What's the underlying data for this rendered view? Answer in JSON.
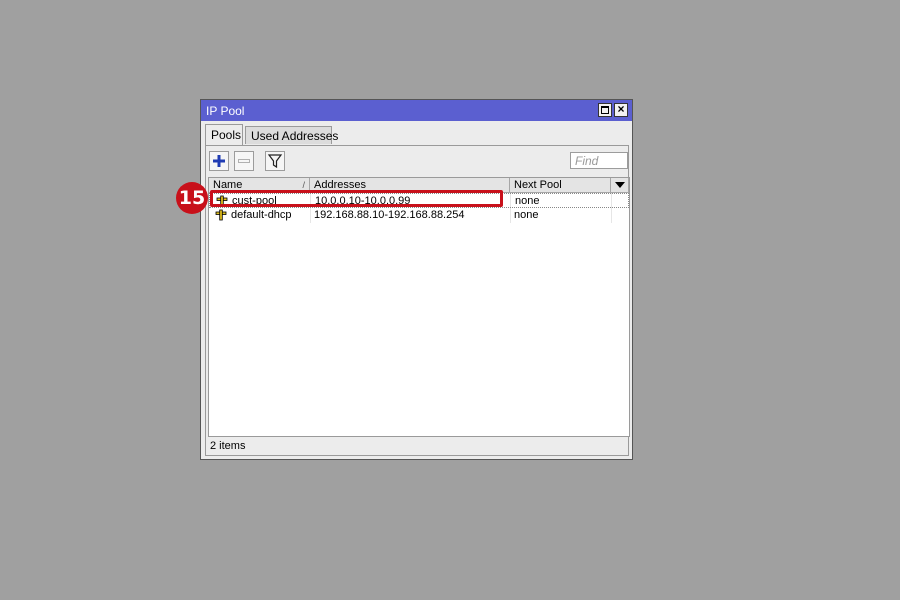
{
  "window": {
    "title": "IP Pool"
  },
  "tabs": [
    {
      "label": "Pools"
    },
    {
      "label": "Used Addresses"
    }
  ],
  "toolbar": {
    "add_icon": "plus-icon",
    "remove_icon": "minus-icon",
    "filter_icon": "filter-icon",
    "find_placeholder": "Find"
  },
  "table": {
    "columns": [
      "Name",
      "Addresses",
      "Next Pool"
    ],
    "rows": [
      {
        "name": "cust-pool",
        "addresses": "10.0.0.10-10.0.0.99",
        "next_pool": "none"
      },
      {
        "name": "default-dhcp",
        "addresses": "192.168.88.10-192.168.88.254",
        "next_pool": "none"
      }
    ]
  },
  "status": {
    "text": "2 items"
  },
  "annotation": {
    "step": "15"
  },
  "colors": {
    "titlebar": "#5b5fd0",
    "callout": "#c8101a",
    "background": "#a0a0a0"
  }
}
